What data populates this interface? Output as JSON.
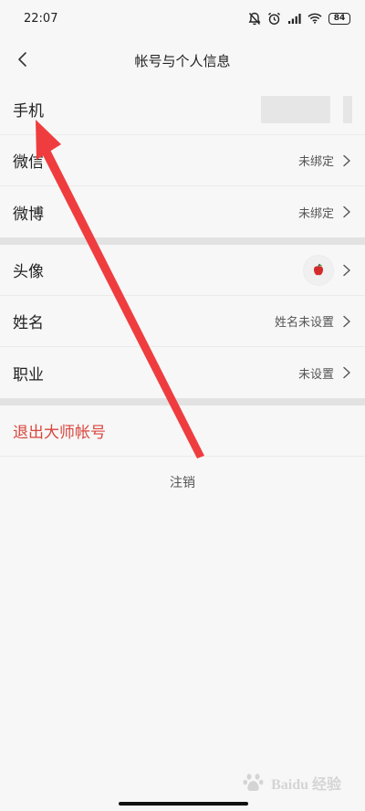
{
  "status_bar": {
    "time": "22:07",
    "battery": "84"
  },
  "header": {
    "title": "帐号与个人信息"
  },
  "section_account": [
    {
      "label": "手机",
      "value": ""
    },
    {
      "label": "微信",
      "value": "未绑定"
    },
    {
      "label": "微博",
      "value": "未绑定"
    }
  ],
  "section_profile": [
    {
      "label": "头像",
      "value": ""
    },
    {
      "label": "姓名",
      "value": "姓名未设置"
    },
    {
      "label": "职业",
      "value": "未设置"
    }
  ],
  "actions": {
    "logout_label": "退出大师帐号",
    "deregister_label": "注销"
  },
  "colors": {
    "danger": "#d9463e",
    "annotation_arrow": "#ef3d3f"
  },
  "watermark": "Baidu 经验"
}
